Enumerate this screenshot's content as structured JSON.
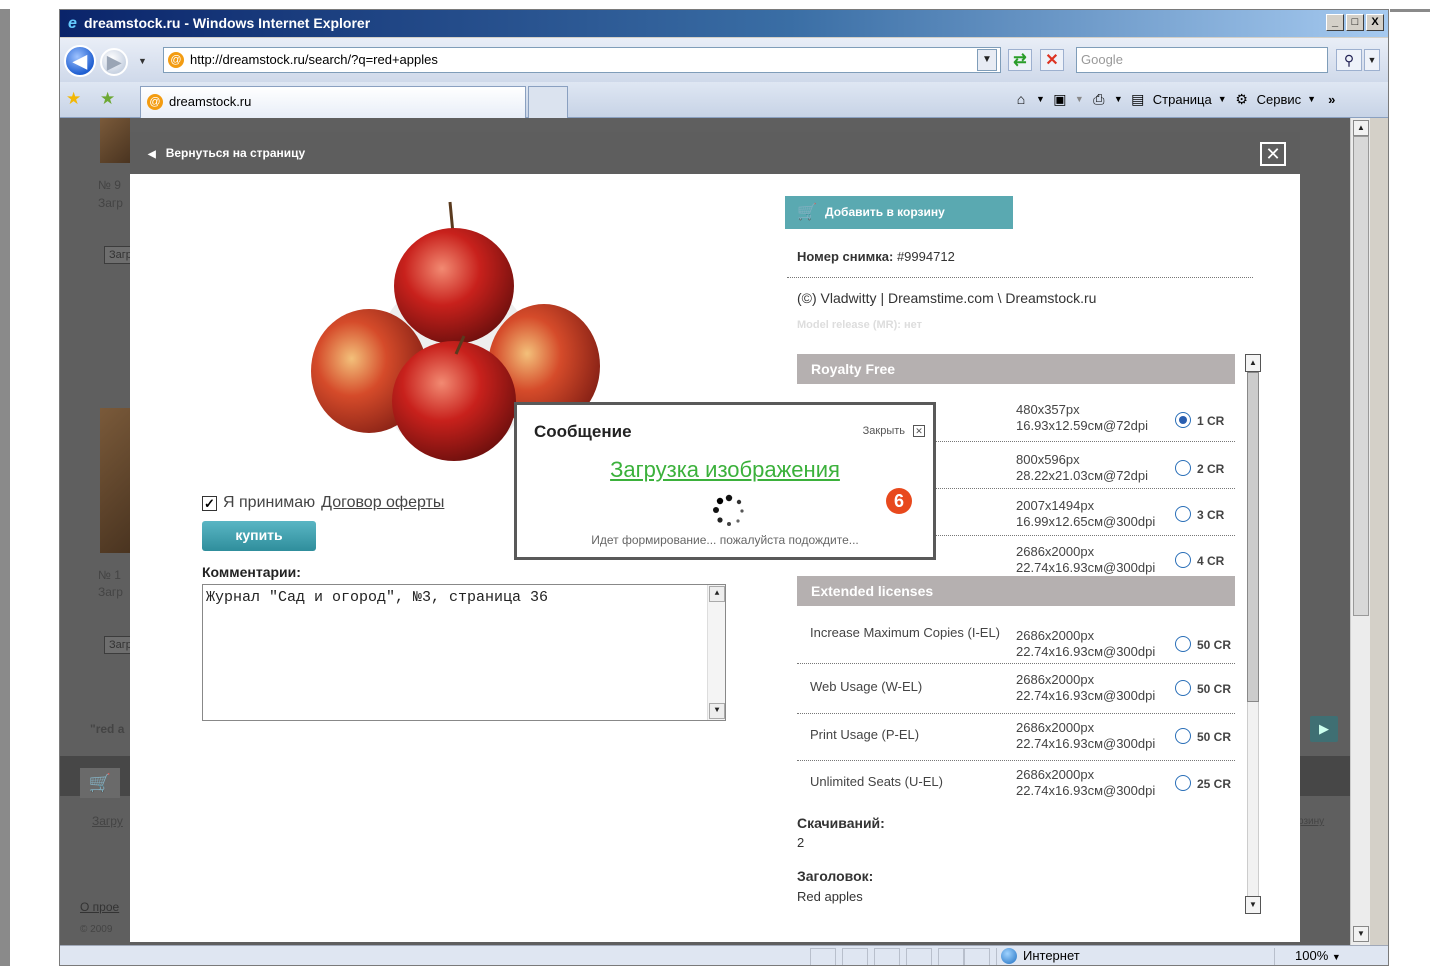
{
  "window": {
    "title": "dreamstock.ru - Windows Internet Explorer",
    "min": "_",
    "max": "□",
    "close": "X"
  },
  "address": {
    "url": "http://dreamstock.ru/search/?q=red+apples",
    "search_placeholder": "Google"
  },
  "tab": {
    "label": "dreamstock.ru"
  },
  "commandbar": {
    "page_label": "Страница",
    "tools_label": "Сервис"
  },
  "lightbox": {
    "back_label": "Вернуться на страницу",
    "close_glyph": "✕",
    "agree_text": "Я принимаю",
    "agree_link": "Договор оферты",
    "buy_label": "купить",
    "comments_label": "Комментарии:",
    "comments_value": "Журнал \"Сад и огород\", №3, страница 36",
    "cart_label": "Добавить в корзину",
    "photo_no_label": "Номер снимка:",
    "photo_no_value": "#9994712",
    "credit": "(©) Vladwitty | Dreamstime.com \\ Dreamstock.ru",
    "model_release": "Model release (MR): нет",
    "royalty_header": "Royalty Free",
    "extended_header": "Extended licenses",
    "royalty_rows": [
      {
        "size": "480x357px",
        "dims": "16.93x12.59см@72dpi",
        "cr": "1 CR",
        "selected": true
      },
      {
        "size": "800x596px",
        "dims": "28.22x21.03см@72dpi",
        "cr": "2 CR",
        "selected": false
      },
      {
        "size": "2007x1494px",
        "dims": "16.99x12.65см@300dpi",
        "cr": "3 CR",
        "selected": false
      },
      {
        "size": "2686x2000px",
        "dims": "22.74x16.93см@300dpi",
        "cr": "4 CR",
        "selected": false
      }
    ],
    "extended_rows": [
      {
        "name": "Increase Maximum Copies (I-EL)",
        "size": "2686x2000px",
        "dims": "22.74x16.93см@300dpi",
        "cr": "50 CR"
      },
      {
        "name": "Web Usage (W-EL)",
        "size": "2686x2000px",
        "dims": "22.74x16.93см@300dpi",
        "cr": "50 CR"
      },
      {
        "name": "Print Usage (P-EL)",
        "size": "2686x2000px",
        "dims": "22.74x16.93см@300dpi",
        "cr": "50 CR"
      },
      {
        "name": "Unlimited Seats (U-EL)",
        "size": "2686x2000px",
        "dims": "22.74x16.93см@300dpi",
        "cr": "25 CR"
      }
    ],
    "downloads_label": "Скачиваний:",
    "downloads_value": "2",
    "heading_label": "Заголовок:",
    "heading_value": "Red apples"
  },
  "message": {
    "title": "Сообщение",
    "close_label": "Закрыть",
    "loading": "Загрузка изображения",
    "hint": "Идет формирование... пожалуйста подождите..."
  },
  "badge": "6",
  "background": {
    "item_no_1": "№ 9",
    "item_no_2": "№ 1",
    "load_short": "Загр",
    "zagr_btn": "Загр",
    "query": "\"red a",
    "footer_link": "Загру",
    "about": "О прое",
    "copy": "© 2009",
    "right_link": "рзину"
  },
  "status": {
    "zone": "Интернет",
    "zoom": "100%"
  }
}
